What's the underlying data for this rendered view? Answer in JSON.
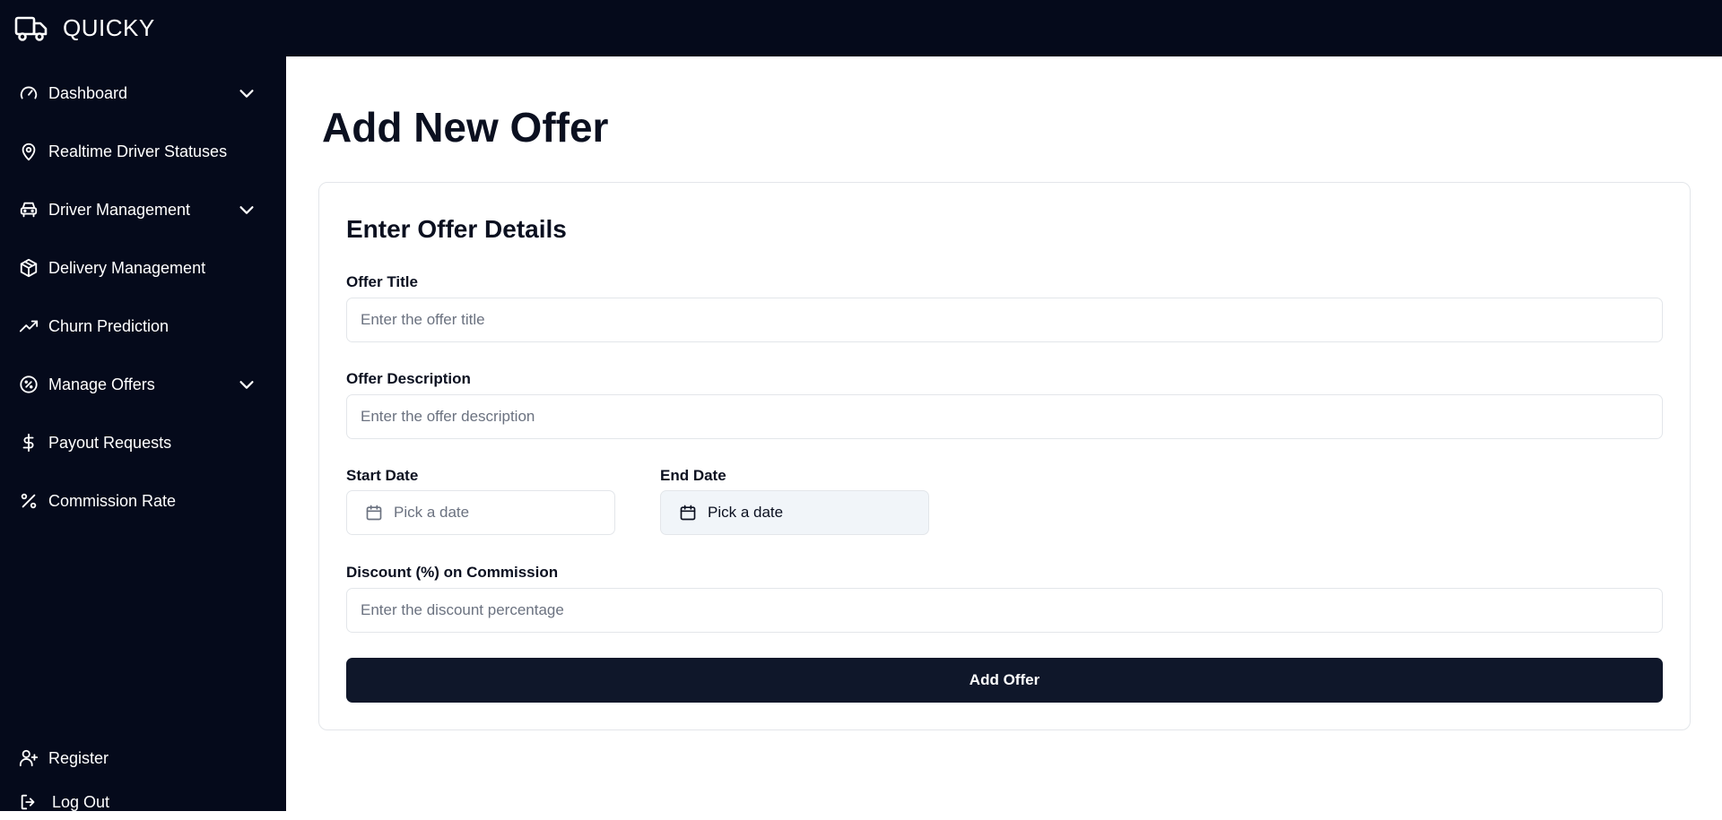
{
  "app": {
    "title": "QUICKY",
    "brand_color": "#050a1b"
  },
  "sidebar": {
    "items": [
      {
        "label": "Dashboard",
        "icon": "gauge-icon",
        "has_chevron": true
      },
      {
        "label": "Realtime Driver Statuses",
        "icon": "map-pin-icon",
        "has_chevron": false
      },
      {
        "label": "Driver Management",
        "icon": "car-icon",
        "has_chevron": true
      },
      {
        "label": "Delivery Management",
        "icon": "package-icon",
        "has_chevron": false
      },
      {
        "label": "Churn Prediction",
        "icon": "trending-down-icon",
        "has_chevron": false
      },
      {
        "label": "Manage Offers",
        "icon": "badge-percent-icon",
        "has_chevron": true
      },
      {
        "label": "Payout Requests",
        "icon": "dollar-icon",
        "has_chevron": false
      },
      {
        "label": "Commission Rate",
        "icon": "percent-icon",
        "has_chevron": false
      }
    ],
    "footer": [
      {
        "label": "Register",
        "icon": "user-plus-icon"
      },
      {
        "label": "Log Out",
        "icon": "log-out-icon"
      }
    ]
  },
  "main": {
    "page_title": "Add New Offer",
    "card_title": "Enter Offer Details",
    "form": {
      "offer_title": {
        "label": "Offer Title",
        "placeholder": "Enter the offer title",
        "value": ""
      },
      "offer_description": {
        "label": "Offer Description",
        "placeholder": "Enter the offer description",
        "value": ""
      },
      "start_date": {
        "label": "Start Date",
        "text": "Pick a date"
      },
      "end_date": {
        "label": "End Date",
        "text": "Pick a date"
      },
      "discount": {
        "label": "Discount (%) on Commission",
        "placeholder": "Enter the discount percentage",
        "value": ""
      },
      "submit_label": "Add Offer"
    }
  }
}
